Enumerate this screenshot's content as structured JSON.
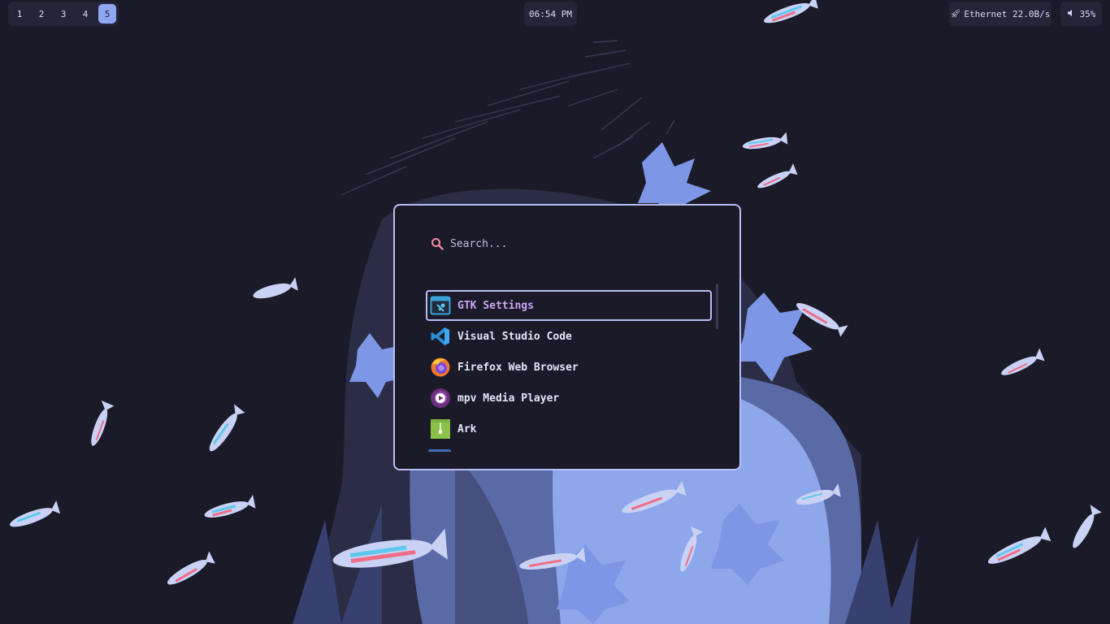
{
  "topbar": {
    "workspaces": [
      "1",
      "2",
      "3",
      "4",
      "5"
    ],
    "active_workspace": "5",
    "clock": "06:54 PM",
    "network": {
      "icon": "rocket-icon",
      "label": "Ethernet 22.0B/s"
    },
    "volume": {
      "icon": "speaker-icon",
      "label": "35%"
    }
  },
  "launcher": {
    "search": {
      "placeholder": "Search...",
      "value": "",
      "icon": "search-icon"
    },
    "results": [
      {
        "label": "GTK Settings",
        "icon": "gtk-settings-icon",
        "selected": true
      },
      {
        "label": "Visual Studio Code",
        "icon": "vscode-icon",
        "selected": false
      },
      {
        "label": "Firefox Web Browser",
        "icon": "firefox-icon",
        "selected": false
      },
      {
        "label": "mpv Media Player",
        "icon": "mpv-icon",
        "selected": false
      },
      {
        "label": "Ark",
        "icon": "ark-icon",
        "selected": false
      }
    ]
  },
  "colors": {
    "background": "#1b1a28",
    "bar_pill": "#25253a",
    "accent": "#8fa6f2",
    "launcher_border": "#b7bff5",
    "selected_text": "#c9a7f4",
    "search_icon": "#f08aa3"
  }
}
